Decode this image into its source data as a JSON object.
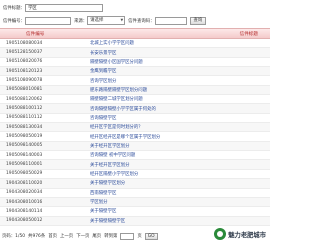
{
  "search": {
    "title_label": "信件标题：",
    "title_value": "学区",
    "code_label": "信件编号：",
    "source_label": "来源：",
    "source_selected": "请选择",
    "query_code_label": "信件查询码：",
    "search_button": "查询"
  },
  "table": {
    "headers": {
      "number": "信件编号",
      "title": "信件标题"
    },
    "rows": [
      {
        "number": "1905108080034",
        "title": "北城上实小学学区问题"
      },
      {
        "number": "1905128150037",
        "title": "长安乐景学区"
      },
      {
        "number": "1905108020076",
        "title": "隔壁隔壁小区国学区分问题"
      },
      {
        "number": "1905108120123",
        "title": "金鹰到瞻学区"
      },
      {
        "number": "1905108090078",
        "title": "咨询学区划分"
      },
      {
        "number": "1905088010081",
        "title": "肥东路隔壁隔壁学区划分问题"
      },
      {
        "number": "1905088120062",
        "title": "隔壁隔壁二城学区划分问题"
      },
      {
        "number": "1905088100112",
        "title": "咨询隔壁隔壁小学学区属于何处的"
      },
      {
        "number": "1905088110112",
        "title": "咨询隔壁学区"
      },
      {
        "number": "1905088130034",
        "title": "经开区学区是何时划分的？"
      },
      {
        "number": "1905098050019",
        "title": "经开区经开区是哪个区属于学区划分"
      },
      {
        "number": "1905098140005",
        "title": "关于经开区学区划分"
      },
      {
        "number": "1905098140003",
        "title": "咨询隔壁 初中学区问题"
      },
      {
        "number": "1905098110001",
        "title": "关于经开区学区划分"
      },
      {
        "number": "1905098050029",
        "title": "经开区隔壁小学学区划分"
      },
      {
        "number": "1904308110020",
        "title": "关于隔壁学区划分"
      },
      {
        "number": "1904308020034",
        "title": "西南隔壁学区"
      },
      {
        "number": "1904308010016",
        "title": "学区划分"
      },
      {
        "number": "1904308140114",
        "title": "关于隔壁学区"
      },
      {
        "number": "1904308050012",
        "title": "关于隔壁隔壁学区"
      }
    ]
  },
  "pager": {
    "page_info": "页码：1/50",
    "total": "共976条",
    "first": "首页",
    "prev": "上一页",
    "next": "下一页",
    "last": "尾页",
    "jump_label": "转到第",
    "jump_unit": "页",
    "go": "GO"
  },
  "watermark": {
    "text": "魅力老肥城市"
  }
}
